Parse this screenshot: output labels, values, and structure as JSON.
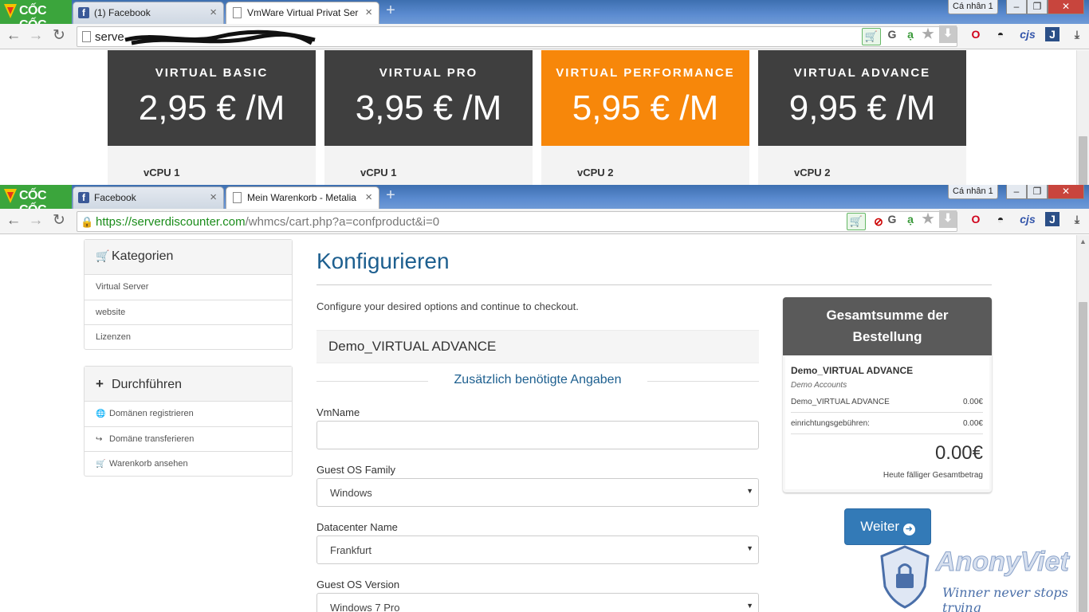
{
  "browser_top": {
    "brand": "CỐC CỐC",
    "tabs": [
      {
        "title": "(1) Facebook",
        "favicon": "facebook-icon"
      },
      {
        "title": "VmWare Virtual Privat Ser",
        "favicon": "document-icon"
      }
    ],
    "user": "Cá nhân 1",
    "url": "serve"
  },
  "pricing": [
    {
      "name": "VIRTUAL BASIC",
      "price": "2,95 € /M",
      "spec": "vCPU 1"
    },
    {
      "name": "VIRTUAL PRO",
      "price": "3,95 € /M",
      "spec": "vCPU 1"
    },
    {
      "name": "VIRTUAL PERFORMANCE",
      "price": "5,95 € /M",
      "spec": "vCPU 2"
    },
    {
      "name": "VIRTUAL ADVANCE",
      "price": "9,95 € /M",
      "spec": "vCPU 2"
    }
  ],
  "browser_bottom": {
    "brand": "CỐC CỐC",
    "tabs": [
      {
        "title": "Facebook",
        "favicon": "facebook-icon"
      },
      {
        "title": "Mein Warenkorb - Metalia",
        "favicon": "document-icon"
      }
    ],
    "user": "Cá nhân 1",
    "url_secure": "https://serverdiscounter.com",
    "url_rest": "/whmcs/cart.php?a=confproduct&i=0"
  },
  "sidebar": {
    "categories_title": "Kategorien",
    "categories": [
      "Virtual Server",
      "website",
      "Lizenzen"
    ],
    "actions_title": "Durchführen",
    "actions": [
      {
        "label": "Domänen registrieren",
        "icon": "globe-icon"
      },
      {
        "label": "Domäne transferieren",
        "icon": "share-icon"
      },
      {
        "label": "Warenkorb ansehen",
        "icon": "cart-icon"
      }
    ]
  },
  "main": {
    "title": "Konfigurieren",
    "intro": "Configure your desired options and continue to checkout.",
    "product": "Demo_VIRTUAL ADVANCE",
    "section_title": "Zusätzlich benötigte Angaben",
    "fields": [
      {
        "label": "VmName",
        "value": ""
      },
      {
        "label": "Guest OS Family",
        "value": "Windows"
      },
      {
        "label": "Datacenter Name",
        "value": "Frankfurt"
      },
      {
        "label": "Guest OS Version",
        "value": "Windows 7 Pro"
      }
    ]
  },
  "summary": {
    "title": "Gesamtsumme der Bestellung",
    "product": "Demo_VIRTUAL ADVANCE",
    "group": "Demo Accounts",
    "line_label": "Demo_VIRTUAL ADVANCE",
    "line_price": "0.00€",
    "setup_label": "einrichtungsgebühren:",
    "setup_price": "0.00€",
    "total": "0.00€",
    "total_label": "Heute fälliger Gesamtbetrag"
  },
  "button": {
    "continue_label": "Weiter"
  },
  "watermark": {
    "title": "AnonyViet",
    "slogan": "Winner never stops trying"
  },
  "colors": {
    "accent": "#337ab7",
    "highlight": "#f7870a",
    "dark_card": "#3f3f3f",
    "brand_green": "#3ba53c"
  }
}
